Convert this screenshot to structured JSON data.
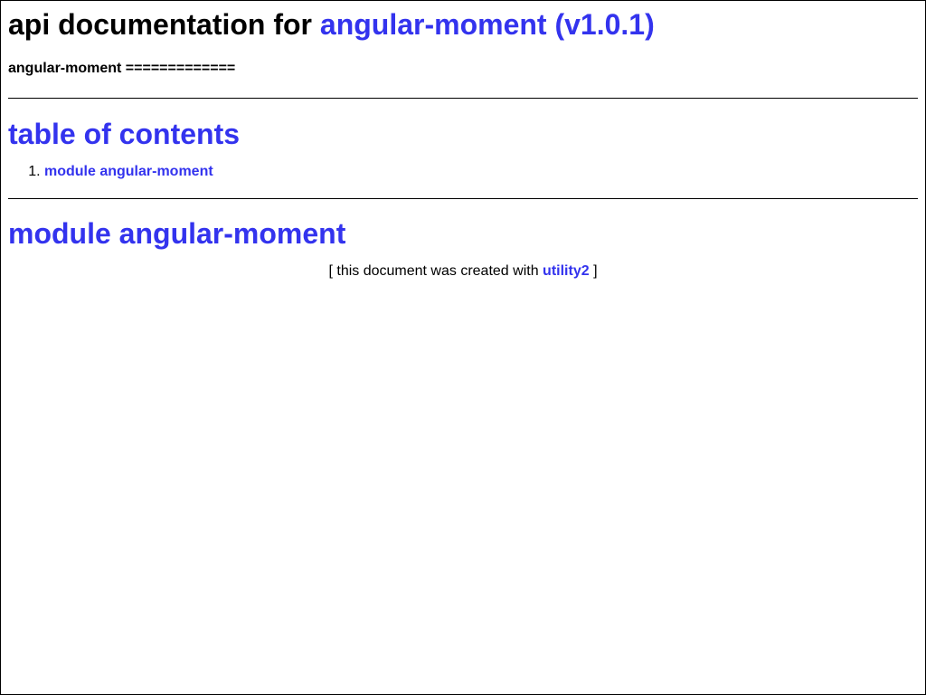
{
  "header": {
    "title_prefix": "api documentation for",
    "title_link": "angular-moment (v1.0.1)",
    "subtitle": "angular-moment ============="
  },
  "toc": {
    "title": "table of contents",
    "items": [
      {
        "number": "1.",
        "label": "module angular-moment"
      }
    ]
  },
  "module": {
    "title": "module angular-moment"
  },
  "footer": {
    "prefix": "[ this document was created with",
    "link": "utility2",
    "suffix": "]"
  },
  "colors": {
    "link": "#3333ee",
    "text": "#000000",
    "background": "#ffffff"
  }
}
